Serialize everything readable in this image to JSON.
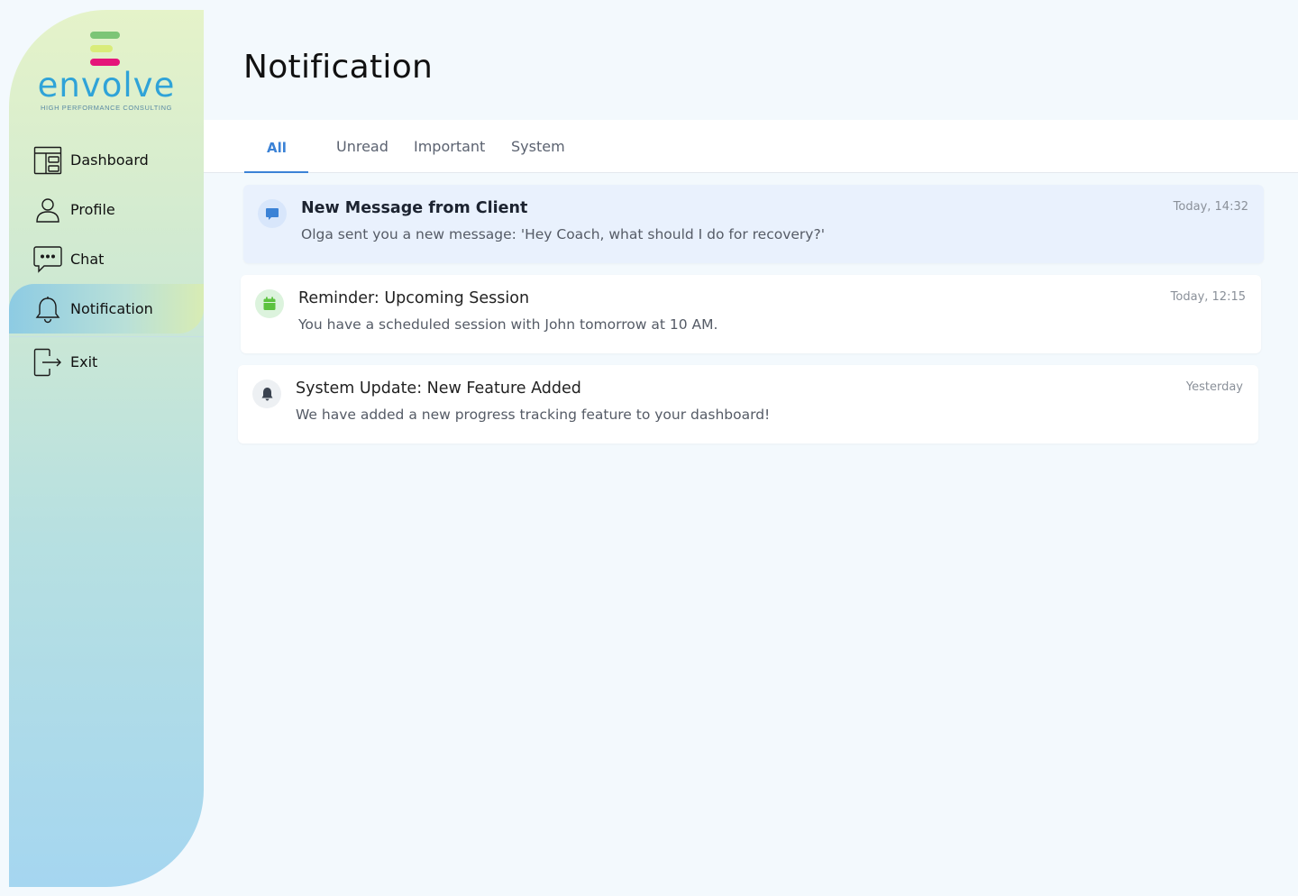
{
  "brand": {
    "name": "envolve",
    "tagline": "HIGH PERFORMANCE CONSULTING",
    "colors": {
      "green": "#7cc576",
      "lime": "#d9ec7a",
      "pink": "#e5157a",
      "blue": "#2fa3d8"
    }
  },
  "sidebar": {
    "items": [
      {
        "label": "Dashboard",
        "icon": "dashboard-layout-icon",
        "active": false
      },
      {
        "label": "Profile",
        "icon": "user-icon",
        "active": false
      },
      {
        "label": "Chat",
        "icon": "chat-bubble-icon",
        "active": false
      },
      {
        "label": "Notification",
        "icon": "bell-icon",
        "active": true
      },
      {
        "label": "Exit",
        "icon": "logout-icon",
        "active": false
      }
    ]
  },
  "page": {
    "title": "Notification"
  },
  "tabs": [
    {
      "label": "All",
      "active": true
    },
    {
      "label": "Unread",
      "active": false
    },
    {
      "label": "Important",
      "active": false
    },
    {
      "label": "System",
      "active": false
    }
  ],
  "notifications": [
    {
      "title": "New Message from Client",
      "message": "Olga sent you a new message: 'Hey Coach, what should I do for recovery?'",
      "time": "Today, 14:32",
      "icon": "message-icon",
      "unread": true,
      "accent": "#3b82d6"
    },
    {
      "title": "Reminder: Upcoming Session",
      "message": "You have a scheduled session with John tomorrow at 10 AM.",
      "time": "Today, 12:15",
      "icon": "calendar-icon",
      "unread": false,
      "accent": "#5cc23f"
    },
    {
      "title": "System Update: New Feature Added",
      "message": "We have added a new progress tracking feature to your dashboard!",
      "time": "Yesterday",
      "icon": "bell-icon",
      "unread": false,
      "accent": "#3b4350"
    }
  ],
  "colors": {
    "accent": "#3b82d6",
    "background": "#f3f9fd"
  }
}
